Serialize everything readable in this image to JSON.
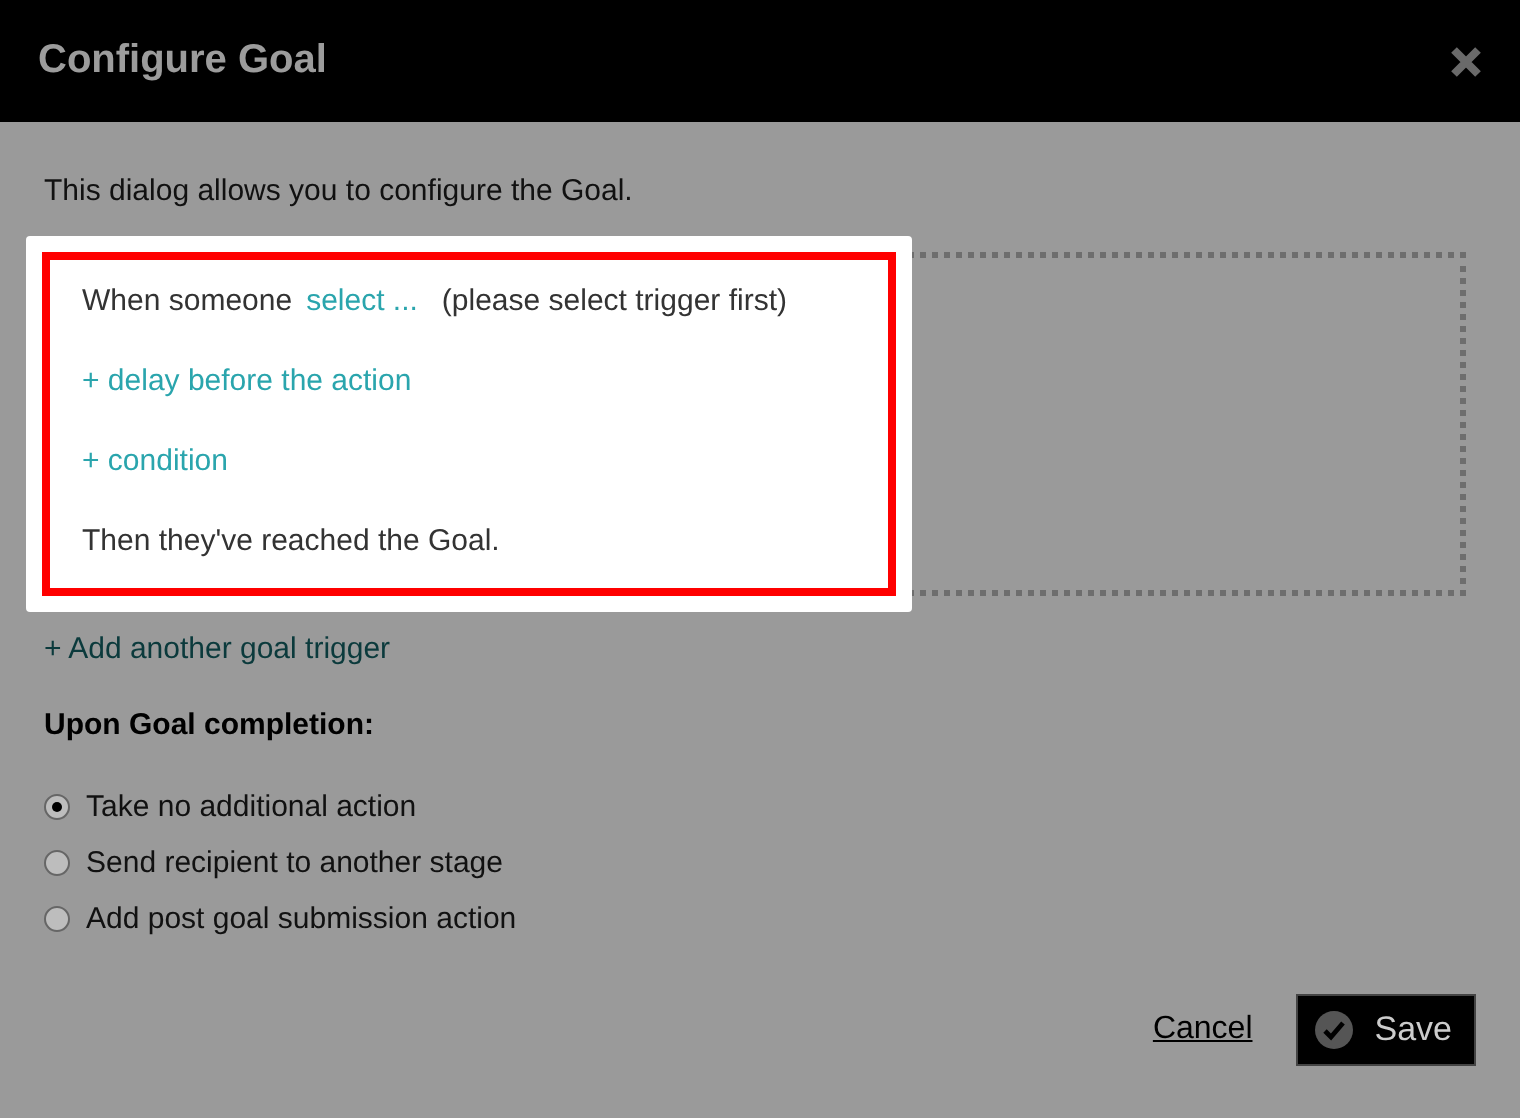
{
  "dialog": {
    "title": "Configure Goal",
    "description": "This dialog allows you to configure the Goal."
  },
  "trigger": {
    "highlighted": true,
    "prefix": "When someone",
    "select_link": "select ...",
    "hint": "(please select trigger first)",
    "actions": [
      "+ delay before the action",
      "+ condition"
    ],
    "conclusion": "Then they've reached the Goal."
  },
  "add_trigger": "+ Add another goal trigger",
  "completion": {
    "heading": "Upon Goal completion:",
    "options": [
      {
        "label": "Take no additional action",
        "selected": true
      },
      {
        "label": "Send recipient to another stage",
        "selected": false
      },
      {
        "label": "Add post goal submission action",
        "selected": false
      }
    ]
  },
  "buttons": {
    "cancel": "Cancel",
    "save": "Save"
  }
}
